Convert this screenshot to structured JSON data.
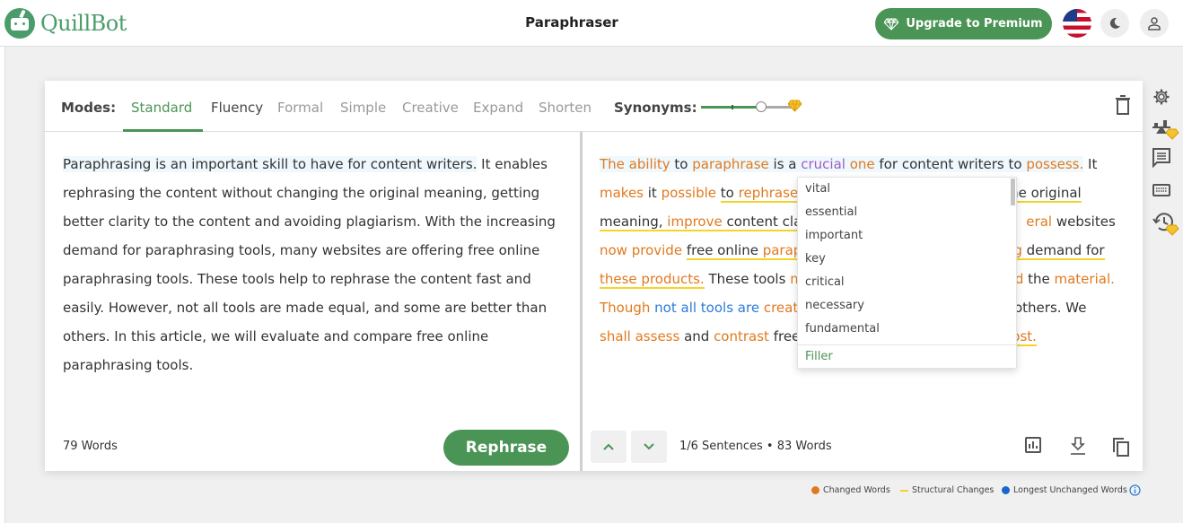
{
  "header": {
    "logo_text": "QuillBot",
    "title": "Paraphraser",
    "upgrade_label": "Upgrade to Premium"
  },
  "modes": {
    "label": "Modes:",
    "items": [
      "Standard",
      "Fluency",
      "Formal",
      "Simple",
      "Creative",
      "Expand",
      "Shorten"
    ],
    "active": "Standard",
    "synonyms_label": "Synonyms:",
    "synonyms_level_fraction": 0.6
  },
  "input": {
    "sentences": [
      "Paraphrasing is an important skill to have for content writers.",
      " It enables rephrasing the content without changing the original meaning, getting better clarity to the content and avoiding plagiarism. With the increasing demand for paraphrasing tools, many websites are offering free online paraphrasing tools. These tools help to rephrase the content fast and easily. However, not all tools are made equal, and some are better than others. In this article, we will evaluate and compare free online paraphrasing tools."
    ],
    "word_count": "79 Words",
    "rephrase_label": "Rephrase"
  },
  "output": {
    "segments": {
      "s0": "The ability",
      "s1": " to ",
      "s2": "paraphrase",
      "s3": " is a ",
      "s4": "crucial",
      "s5": " ",
      "s6": "one",
      "s7": " for content writers to ",
      "s8": "possess.",
      "s9": " It",
      "s10": "makes",
      "s11": " it ",
      "s12": "possible",
      "s13": " ",
      "s14": "to ",
      "s15": "rephrase",
      "s16": "he original",
      "s17": "meaning,",
      "s18": " ",
      "s19": "improve",
      "s20": " content cla",
      "s21": "eral",
      "s22": " websites",
      "s23": "now provide",
      "s24": " ",
      "s25": "free online ",
      "s26": "parap",
      "s27": "g",
      "s28": " demand for",
      "s29": "these products.",
      "s30": " These tools ",
      "s31": "m",
      "s32": "d",
      "s33": " the ",
      "s34": "material.",
      "s35": "Though",
      "s36": " ",
      "s37": "not all tools are",
      "s38": " ",
      "s39": "creat",
      "s40": " others. We",
      "s41": "shall assess",
      "s42": " and ",
      "s43": "contrast",
      "s44": " free",
      "s45": "ost."
    },
    "sentence_info": "1/6 Sentences",
    "word_count": "83 Words"
  },
  "synonym_dropdown": {
    "options": [
      "vital",
      "essential",
      "important",
      "key",
      "critical",
      "necessary",
      "fundamental"
    ],
    "filler_label": "Filler"
  },
  "legend": {
    "changed": "Changed Words",
    "structural": "Structural Changes",
    "unchanged": "Longest Unchanged Words",
    "colors": {
      "changed": "#e07a1f",
      "structural": "#f5d327",
      "unchanged": "#2c7bd6",
      "accent": "#4a9456"
    }
  },
  "side_tools": [
    "settings-icon",
    "compare-modes-icon",
    "feedback-icon",
    "keyboard-icon",
    "history-icon"
  ]
}
